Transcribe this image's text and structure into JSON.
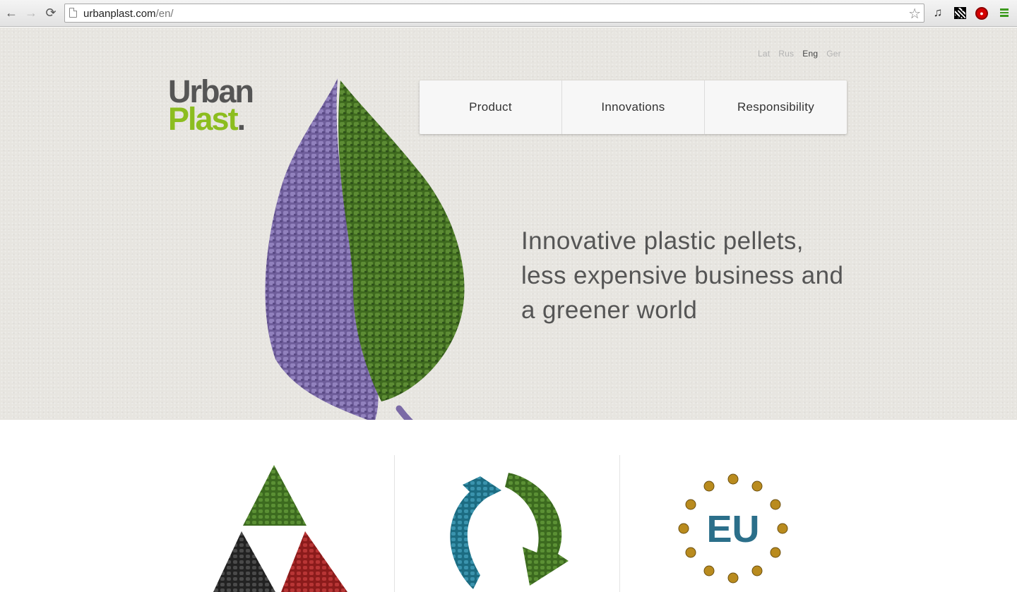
{
  "browser": {
    "url_host": "urbanplast.com",
    "url_path": "/en/",
    "nav": {
      "back": "←",
      "forward": "→",
      "reload": "⟳"
    },
    "extensions": [
      "music-note-icon",
      "qr-code-icon",
      "stop-icon",
      "chrome-menu-icon"
    ]
  },
  "header": {
    "languages": [
      {
        "label": "Lat",
        "active": false
      },
      {
        "label": "Rus",
        "active": false
      },
      {
        "label": "Eng",
        "active": true
      },
      {
        "label": "Ger",
        "active": false
      }
    ],
    "logo": {
      "line1": "Urban",
      "line2": "Plast",
      "dot": "."
    },
    "menu": [
      {
        "label": "Product"
      },
      {
        "label": "Innovations"
      },
      {
        "label": "Responsibility"
      }
    ]
  },
  "hero": {
    "tagline": "Innovative plastic pellets, less expensive business and a greener world"
  },
  "features": {
    "items": [
      {
        "icon": "triangle-pellets-icon"
      },
      {
        "icon": "recycle-arrows-icon"
      },
      {
        "icon": "eu-stars-icon",
        "badge": "EU"
      }
    ]
  },
  "colors": {
    "brand_green": "#8cbd1f",
    "brand_gray": "#555555",
    "leaf_purple": "#7b6aa6",
    "leaf_green": "#4f7a2a"
  }
}
